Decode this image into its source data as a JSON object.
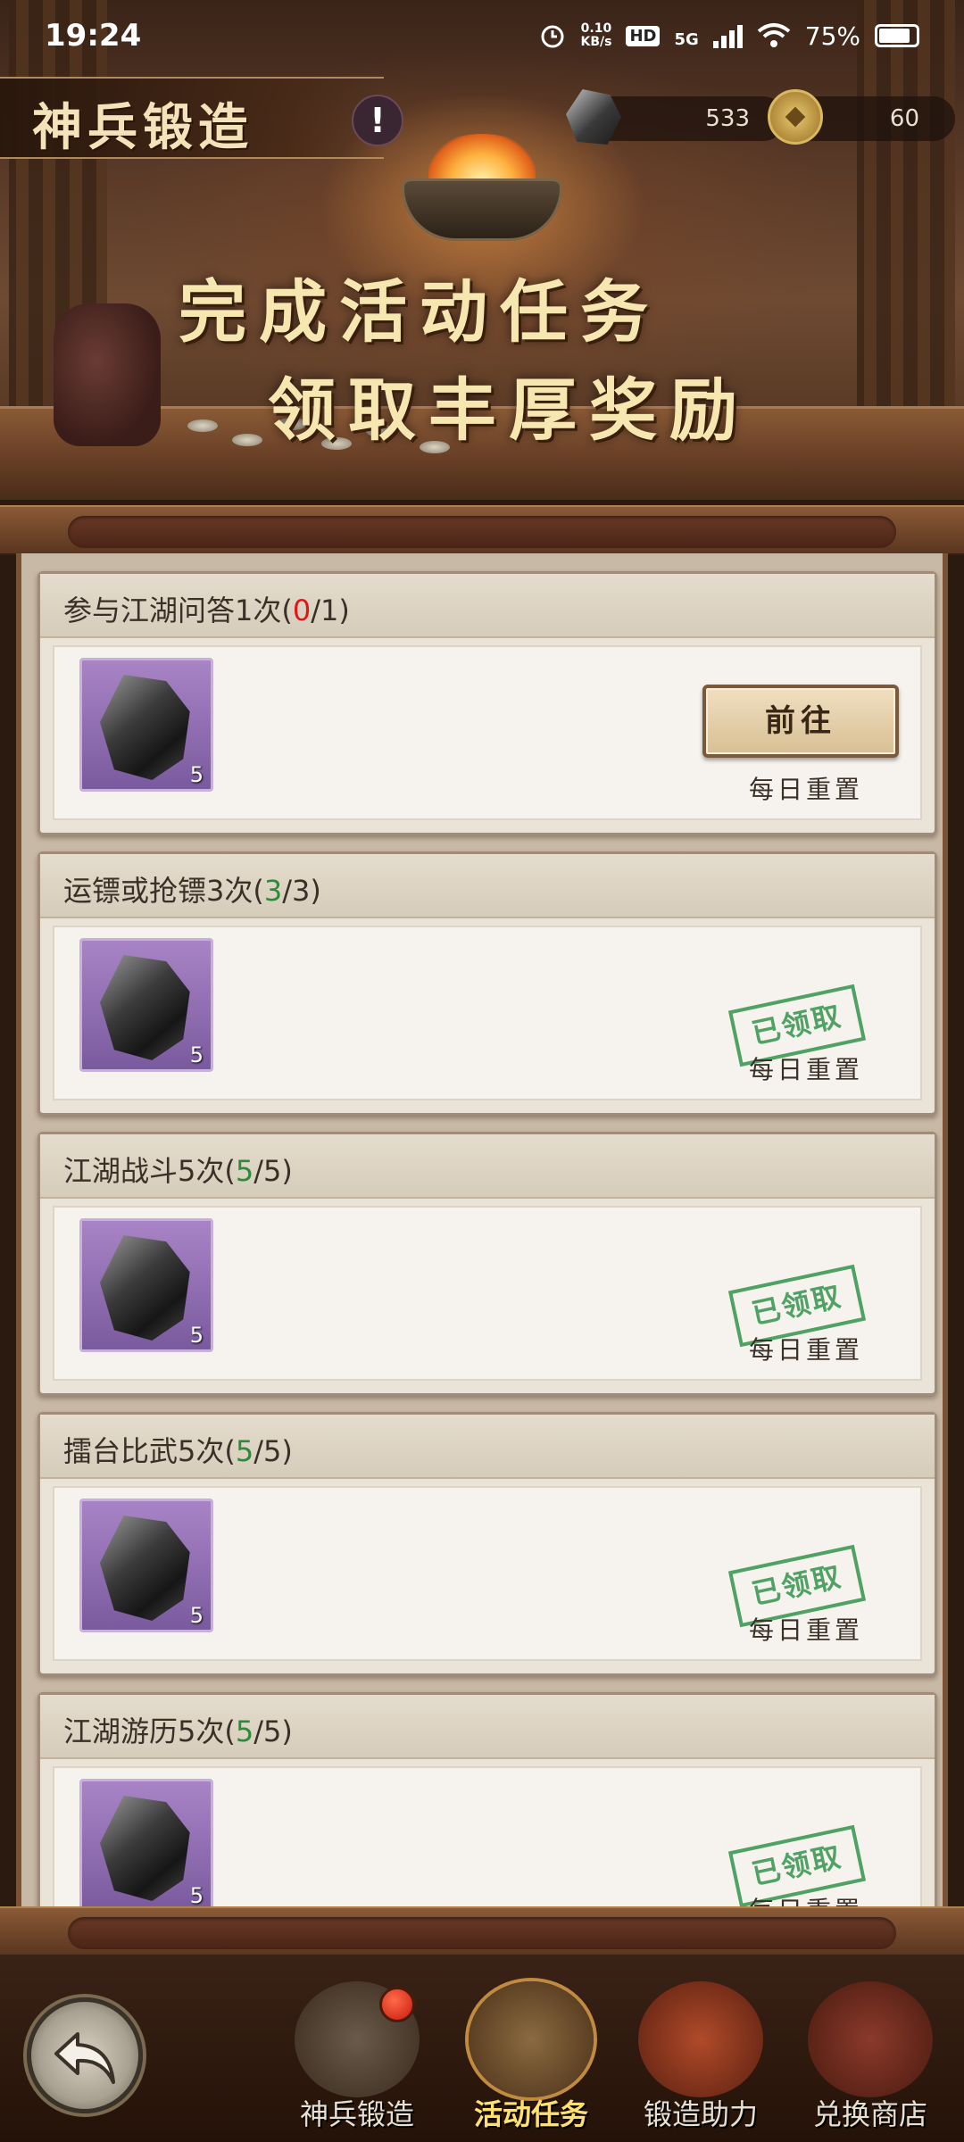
{
  "status_bar": {
    "time": "19:24",
    "net_speed": "0.10",
    "net_unit": "KB/s",
    "hd": "HD",
    "network": "5G",
    "battery": "75%"
  },
  "header": {
    "title": "神兵锻造",
    "info": "!",
    "ore_count": "533",
    "coin_count": "60",
    "slogan_line1": "完成活动任务",
    "slogan_line2": "领取丰厚奖励"
  },
  "tasks": [
    {
      "name": "参与江湖问答1次(",
      "done": "0",
      "total": "/1)",
      "reward_count": "5",
      "action": "前往",
      "status": "",
      "reset": "每日重置"
    },
    {
      "name": "运镖或抢镖3次(",
      "done": "3",
      "total": "/3)",
      "reward_count": "5",
      "action": "",
      "status": "已领取",
      "reset": "每日重置"
    },
    {
      "name": "江湖战斗5次(",
      "done": "5",
      "total": "/5)",
      "reward_count": "5",
      "action": "",
      "status": "已领取",
      "reset": "每日重置"
    },
    {
      "name": "擂台比武5次(",
      "done": "5",
      "total": "/5)",
      "reward_count": "5",
      "action": "",
      "status": "已领取",
      "reset": "每日重置"
    },
    {
      "name": "江湖游历5次(",
      "done": "5",
      "total": "/5)",
      "reward_count": "5",
      "action": "",
      "status": "已领取",
      "reset": "每日重置"
    }
  ],
  "nav": {
    "tabs": [
      "神兵锻造",
      "活动任务",
      "锻造助力",
      "兑换商店"
    ],
    "active": "活动任务"
  },
  "colors": {
    "progress_done": "#2e8a3a",
    "progress_none": "#e01818",
    "stamp": "#3e9a56",
    "active_tab": "#ffe070"
  }
}
